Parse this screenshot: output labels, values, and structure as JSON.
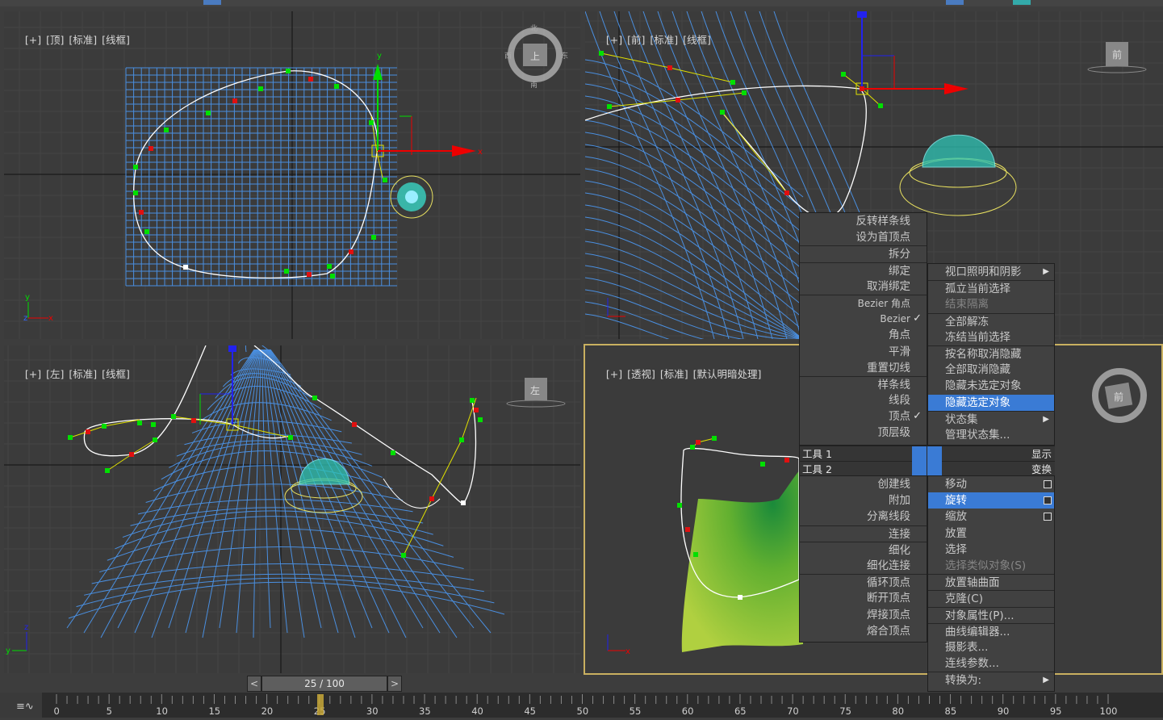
{
  "viewports": {
    "top": {
      "labels": [
        "[+]",
        "[顶]",
        "[标准]",
        "[线框]"
      ],
      "cube_label": "上",
      "compass": {
        "n": "北",
        "s": "南",
        "e": "东",
        "w": "西"
      }
    },
    "front": {
      "labels": [
        "[+]",
        "[前]",
        "[标准]",
        "[线框]"
      ],
      "cube_label": "前"
    },
    "left": {
      "labels": [
        "[+]",
        "[左]",
        "[标准]",
        "[线框]"
      ],
      "cube_label": "左"
    },
    "persp": {
      "labels": [
        "[+]",
        "[透视]",
        "[标准]",
        "[默认明暗处理]"
      ],
      "cube_label": "前"
    }
  },
  "axes": {
    "x": "x",
    "y": "y",
    "z": "z"
  },
  "quad_menu": {
    "left_items": [
      {
        "label": "反转样条线"
      },
      {
        "label": "设为首顶点"
      },
      {
        "label": "拆分",
        "sep": true
      },
      {
        "label": "绑定",
        "sep": true
      },
      {
        "label": "取消绑定"
      },
      {
        "label": "Bezier 角点",
        "sep": true,
        "small": true
      },
      {
        "label": "Bezier",
        "small": true,
        "check": "✓"
      },
      {
        "label": "角点"
      },
      {
        "label": "平滑"
      },
      {
        "label": "重置切线"
      },
      {
        "label": "样条线",
        "sep": true
      },
      {
        "label": "线段"
      },
      {
        "label": "顶点",
        "check": "✓"
      },
      {
        "label": "顶层级"
      }
    ],
    "left_items2": [
      {
        "label": "创建线"
      },
      {
        "label": "附加"
      },
      {
        "label": "分离线段"
      },
      {
        "label": "连接",
        "sep": true
      },
      {
        "label": "细化",
        "sep": true
      },
      {
        "label": "细化连接"
      },
      {
        "label": "循环顶点",
        "sep": true
      },
      {
        "label": "断开顶点"
      },
      {
        "label": "焊接顶点"
      },
      {
        "label": "熔合顶点"
      }
    ],
    "right_items": [
      {
        "label": "视口照明和阴影",
        "arrow": "▶"
      },
      {
        "label": "孤立当前选择",
        "sep": true
      },
      {
        "label": "结束隔离",
        "disabled": true
      },
      {
        "label": "全部解冻",
        "sep": true
      },
      {
        "label": "冻结当前选择"
      },
      {
        "label": "按名称取消隐藏",
        "sep": true
      },
      {
        "label": "全部取消隐藏"
      },
      {
        "label": "隐藏未选定对象"
      },
      {
        "label": "隐藏选定对象",
        "highlight": true
      },
      {
        "label": "状态集",
        "sep": true,
        "arrow": "▶"
      },
      {
        "label": "管理状态集..."
      }
    ],
    "right_items2": [
      {
        "label": "移动",
        "box": true
      },
      {
        "label": "旋转",
        "box": true,
        "highlight": true
      },
      {
        "label": "缩放",
        "box": true
      },
      {
        "label": "放置"
      },
      {
        "label": "选择"
      },
      {
        "label": "选择类似对象(S)",
        "disabled": true
      },
      {
        "label": "放置轴曲面",
        "sep": true
      },
      {
        "label": "克隆(C)",
        "sep": true
      },
      {
        "label": "对象属性(P)...",
        "sep": true
      },
      {
        "label": "曲线编辑器...",
        "sep": true
      },
      {
        "label": "摄影表..."
      },
      {
        "label": "连线参数..."
      },
      {
        "label": "转换为:",
        "sep": true,
        "arrow": "▶"
      }
    ],
    "quad_headers": {
      "tools1": "工具 1",
      "tools2": "工具 2",
      "display": "显示",
      "transform": "变换"
    }
  },
  "time_slider": {
    "value": "25 / 100",
    "prev": "<",
    "next": ">",
    "current_frame": 25,
    "total_frames": 100
  },
  "track_ticks": [
    "0",
    "5",
    "10",
    "15",
    "20",
    "25",
    "30",
    "35",
    "40",
    "45",
    "50",
    "55",
    "60",
    "65",
    "70",
    "75",
    "80",
    "85",
    "90",
    "95",
    "100"
  ],
  "colors": {
    "grid": "#4a8fe0",
    "vertex_green": "#00e000",
    "vertex_red": "#e01010",
    "highlight": "#3a7bd5",
    "terrain_green": "#7cc030"
  }
}
